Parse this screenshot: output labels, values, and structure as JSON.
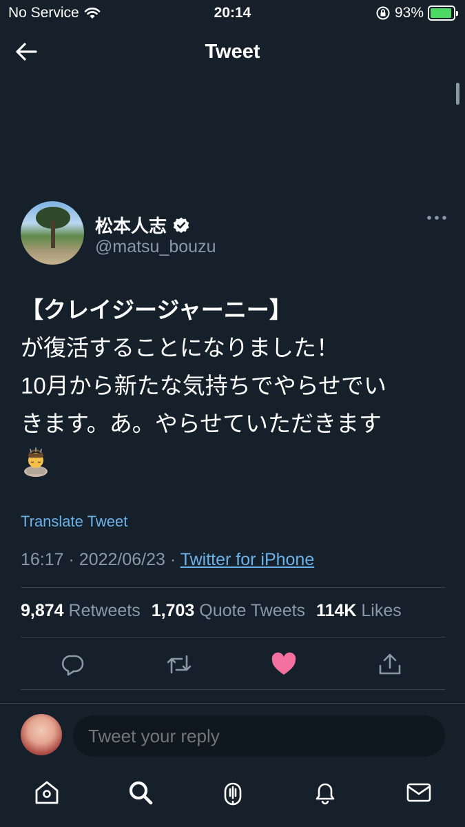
{
  "status_bar": {
    "carrier": "No Service",
    "time": "20:14",
    "battery": "93%",
    "battery_level": 0.93,
    "icons": [
      "wifi-icon",
      "orientation-lock-icon",
      "battery-charging-icon"
    ]
  },
  "header": {
    "title": "Tweet"
  },
  "tweet": {
    "author_name": "松本人志",
    "author_handle": "@matsu_bouzu",
    "lines": [
      "【クレイジージャーニー】",
      "が復活することになりました！",
      "10月から新たな気持ちでやらせでい",
      "きます。あ。やらせていただきます"
    ],
    "translate_label": "Translate Tweet",
    "time": "16:17",
    "date": "2022/06/23",
    "separator": "·",
    "source": "Twitter for iPhone"
  },
  "stats": {
    "retweets_count": "9,874",
    "retweets_label": "Retweets",
    "quotes_count": "1,703",
    "quotes_label": "Quote Tweets",
    "likes_count": "114K",
    "likes_label": "Likes"
  },
  "reply": {
    "placeholder": "Tweet your reply"
  },
  "colors": {
    "background": "#15202b",
    "accent": "#6cb2e8",
    "like": "#f4709f",
    "muted": "#8b98a5",
    "battery": "#4cd964"
  }
}
